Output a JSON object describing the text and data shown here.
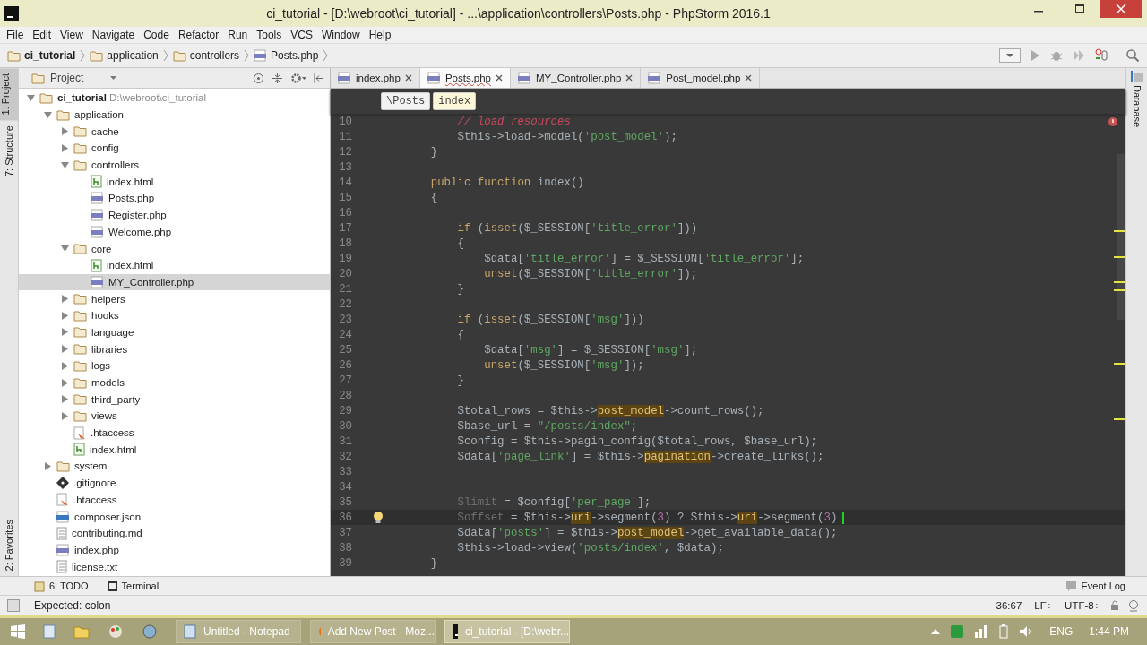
{
  "window": {
    "title": "ci_tutorial - [D:\\webroot\\ci_tutorial] - ...\\application\\controllers\\Posts.php - PhpStorm 2016.1"
  },
  "menu": [
    "File",
    "Edit",
    "View",
    "Navigate",
    "Code",
    "Refactor",
    "Run",
    "Tools",
    "VCS",
    "Window",
    "Help"
  ],
  "nav_bar": [
    {
      "label": "ci_tutorial",
      "kind": "project"
    },
    {
      "label": "application",
      "kind": "folder"
    },
    {
      "label": "controllers",
      "kind": "folder"
    },
    {
      "label": "Posts.php",
      "kind": "php"
    }
  ],
  "left_stripe": [
    {
      "label": "1: Project",
      "selected": true
    },
    {
      "label": "7: Structure",
      "selected": false
    },
    {
      "label": "2: Favorites",
      "selected": false
    }
  ],
  "right_stripe": [
    "Database"
  ],
  "project_panel": {
    "title": "Project",
    "tree": [
      {
        "label": "ci_tutorial",
        "hint": "D:\\webroot\\ci_tutorial",
        "kind": "folder",
        "expanded": true,
        "selected": false,
        "children": [
          {
            "label": "application",
            "kind": "folder",
            "expanded": true,
            "selected": false,
            "children": [
              {
                "label": "cache",
                "kind": "folder",
                "expanded": false,
                "selected": false
              },
              {
                "label": "config",
                "kind": "folder",
                "expanded": false,
                "selected": false
              },
              {
                "label": "controllers",
                "kind": "folder",
                "expanded": true,
                "selected": false,
                "children": [
                  {
                    "label": "index.html",
                    "kind": "html",
                    "selected": false
                  },
                  {
                    "label": "Posts.php",
                    "kind": "php",
                    "selected": false
                  },
                  {
                    "label": "Register.php",
                    "kind": "php",
                    "selected": false
                  },
                  {
                    "label": "Welcome.php",
                    "kind": "php",
                    "selected": false
                  }
                ]
              },
              {
                "label": "core",
                "kind": "folder",
                "expanded": true,
                "selected": false,
                "children": [
                  {
                    "label": "index.html",
                    "kind": "html",
                    "selected": false
                  },
                  {
                    "label": "MY_Controller.php",
                    "kind": "php",
                    "selected": true
                  }
                ]
              },
              {
                "label": "helpers",
                "kind": "folder",
                "expanded": false,
                "selected": false
              },
              {
                "label": "hooks",
                "kind": "folder",
                "expanded": false,
                "selected": false
              },
              {
                "label": "language",
                "kind": "folder",
                "expanded": false,
                "selected": false
              },
              {
                "label": "libraries",
                "kind": "folder",
                "expanded": false,
                "selected": false
              },
              {
                "label": "logs",
                "kind": "folder",
                "expanded": false,
                "selected": false
              },
              {
                "label": "models",
                "kind": "folder",
                "expanded": false,
                "selected": false
              },
              {
                "label": "third_party",
                "kind": "folder",
                "expanded": false,
                "selected": false
              },
              {
                "label": "views",
                "kind": "folder",
                "expanded": false,
                "selected": false
              },
              {
                "label": ".htaccess",
                "kind": "htaccess",
                "selected": false
              },
              {
                "label": "index.html",
                "kind": "html",
                "selected": false
              }
            ]
          },
          {
            "label": "system",
            "kind": "folder",
            "expanded": false,
            "selected": false
          },
          {
            "label": ".gitignore",
            "kind": "git",
            "selected": false
          },
          {
            "label": ".htaccess",
            "kind": "htaccess",
            "selected": false
          },
          {
            "label": "composer.json",
            "kind": "json",
            "selected": false
          },
          {
            "label": "contributing.md",
            "kind": "text",
            "selected": false
          },
          {
            "label": "index.php",
            "kind": "php",
            "selected": false
          },
          {
            "label": "license.txt",
            "kind": "text",
            "selected": false
          }
        ]
      }
    ]
  },
  "editor": {
    "tabs": [
      {
        "label": "index.php",
        "selected": false
      },
      {
        "label": "Posts.php",
        "selected": true
      },
      {
        "label": "MY_Controller.php",
        "selected": false
      },
      {
        "label": "Post_model.php",
        "selected": false
      }
    ],
    "breadcrumb": [
      {
        "label": "\\Posts",
        "selected": false
      },
      {
        "label": "index",
        "selected": true
      }
    ],
    "lines": [
      {
        "number": "10",
        "current": false,
        "tokens": [
          {
            "t": "        // load resources",
            "kind": "comment"
          }
        ]
      },
      {
        "number": "11",
        "current": false,
        "tokens": [
          {
            "t": "        $this->load->model(",
            "kind": "plain"
          },
          {
            "t": "'post_model'",
            "kind": "str"
          },
          {
            "t": ");",
            "kind": "plain"
          }
        ]
      },
      {
        "number": "12",
        "current": false,
        "tokens": [
          {
            "t": "    }",
            "kind": "plain"
          }
        ]
      },
      {
        "number": "13",
        "current": false
      },
      {
        "number": "14",
        "current": false,
        "tokens": [
          {
            "t": "    public function",
            "kind": "kw"
          },
          {
            "t": " index()",
            "kind": "plain"
          }
        ]
      },
      {
        "number": "15",
        "current": false,
        "tokens": [
          {
            "t": "    {",
            "kind": "plain"
          }
        ]
      },
      {
        "number": "16",
        "current": false
      },
      {
        "number": "17",
        "current": false,
        "tokens": [
          {
            "t": "        if",
            "kind": "kw"
          },
          {
            "t": " (",
            "kind": "plain"
          },
          {
            "t": "isset",
            "kind": "kw"
          },
          {
            "t": "($_SESSION[",
            "kind": "plain"
          },
          {
            "t": "'title_error'",
            "kind": "str"
          },
          {
            "t": "]))",
            "kind": "plain"
          }
        ]
      },
      {
        "number": "18",
        "current": false,
        "tokens": [
          {
            "t": "        {",
            "kind": "plain"
          }
        ]
      },
      {
        "number": "19",
        "current": false,
        "tokens": [
          {
            "t": "            $data[",
            "kind": "plain"
          },
          {
            "t": "'title_error'",
            "kind": "str"
          },
          {
            "t": "] = $_SESSION[",
            "kind": "plain"
          },
          {
            "t": "'title_error'",
            "kind": "str"
          },
          {
            "t": "];",
            "kind": "plain"
          }
        ]
      },
      {
        "number": "20",
        "current": false,
        "tokens": [
          {
            "t": "            unset",
            "kind": "kw"
          },
          {
            "t": "($_SESSION[",
            "kind": "plain"
          },
          {
            "t": "'title_error'",
            "kind": "str"
          },
          {
            "t": "]);",
            "kind": "plain"
          }
        ]
      },
      {
        "number": "21",
        "current": false,
        "tokens": [
          {
            "t": "        }",
            "kind": "plain"
          }
        ]
      },
      {
        "number": "22",
        "current": false
      },
      {
        "number": "23",
        "current": false,
        "tokens": [
          {
            "t": "        if",
            "kind": "kw"
          },
          {
            "t": " (",
            "kind": "plain"
          },
          {
            "t": "isset",
            "kind": "kw"
          },
          {
            "t": "($_SESSION[",
            "kind": "plain"
          },
          {
            "t": "'msg'",
            "kind": "str"
          },
          {
            "t": "]))",
            "kind": "plain"
          }
        ]
      },
      {
        "number": "24",
        "current": false,
        "tokens": [
          {
            "t": "        {",
            "kind": "plain"
          }
        ]
      },
      {
        "number": "25",
        "current": false,
        "tokens": [
          {
            "t": "            $data[",
            "kind": "plain"
          },
          {
            "t": "'msg'",
            "kind": "str"
          },
          {
            "t": "] = $_SESSION[",
            "kind": "plain"
          },
          {
            "t": "'msg'",
            "kind": "str"
          },
          {
            "t": "];",
            "kind": "plain"
          }
        ]
      },
      {
        "number": "26",
        "current": false,
        "tokens": [
          {
            "t": "            unset",
            "kind": "kw"
          },
          {
            "t": "($_SESSION[",
            "kind": "plain"
          },
          {
            "t": "'msg'",
            "kind": "str"
          },
          {
            "t": "]);",
            "kind": "plain"
          }
        ]
      },
      {
        "number": "27",
        "current": false,
        "tokens": [
          {
            "t": "        }",
            "kind": "plain"
          }
        ]
      },
      {
        "number": "28",
        "current": false
      },
      {
        "number": "29",
        "current": false,
        "tokens": [
          {
            "t": "        $total_rows = $this->",
            "kind": "plain"
          },
          {
            "t": "post_model",
            "kind": "hl"
          },
          {
            "t": "->count_rows();",
            "kind": "plain"
          }
        ]
      },
      {
        "number": "30",
        "current": false,
        "tokens": [
          {
            "t": "        $base_url = ",
            "kind": "plain"
          },
          {
            "t": "\"/posts/index\"",
            "kind": "str"
          },
          {
            "t": ";",
            "kind": "plain"
          }
        ]
      },
      {
        "number": "31",
        "current": false,
        "tokens": [
          {
            "t": "        $config = $this->pagin_config($total_rows, $base_url);",
            "kind": "plain"
          }
        ]
      },
      {
        "number": "32",
        "current": false,
        "tokens": [
          {
            "t": "        $data[",
            "kind": "plain"
          },
          {
            "t": "'page_link'",
            "kind": "str"
          },
          {
            "t": "] = $this->",
            "kind": "plain"
          },
          {
            "t": "pagination",
            "kind": "hl"
          },
          {
            "t": "->create_links();",
            "kind": "plain"
          }
        ]
      },
      {
        "number": "33",
        "current": false
      },
      {
        "number": "34",
        "current": false
      },
      {
        "number": "35",
        "current": false,
        "tokens": [
          {
            "t": "        $limit",
            "kind": "unused"
          },
          {
            "t": " = $config[",
            "kind": "plain"
          },
          {
            "t": "'per_page'",
            "kind": "str"
          },
          {
            "t": "];",
            "kind": "plain"
          }
        ]
      },
      {
        "number": "36",
        "current": true,
        "tokens": [
          {
            "t": "        $offset",
            "kind": "unused"
          },
          {
            "t": " = $this->",
            "kind": "plain"
          },
          {
            "t": "uri",
            "kind": "hl"
          },
          {
            "t": "->segment(",
            "kind": "plain"
          },
          {
            "t": "3",
            "kind": "num"
          },
          {
            "t": ") ? $this->",
            "kind": "plain"
          },
          {
            "t": "uri",
            "kind": "hl"
          },
          {
            "t": "->segment(",
            "kind": "plain"
          },
          {
            "t": "3",
            "kind": "num"
          },
          {
            "t": ")",
            "kind": "plain"
          }
        ]
      },
      {
        "number": "37",
        "current": false,
        "tokens": [
          {
            "t": "        $data[",
            "kind": "plain"
          },
          {
            "t": "'posts'",
            "kind": "str"
          },
          {
            "t": "] = $this->",
            "kind": "plain"
          },
          {
            "t": "post_model",
            "kind": "hl"
          },
          {
            "t": "->get_available_data();",
            "kind": "plain"
          }
        ]
      },
      {
        "number": "38",
        "current": false,
        "tokens": [
          {
            "t": "        $this->load->view(",
            "kind": "plain"
          },
          {
            "t": "'posts/index'",
            "kind": "str"
          },
          {
            "t": ", $data);",
            "kind": "plain"
          }
        ]
      },
      {
        "number": "39",
        "current": false,
        "tokens": [
          {
            "t": "    }",
            "kind": "plain"
          }
        ]
      }
    ]
  },
  "tool_bar": {
    "left": [
      "6: TODO",
      "Terminal"
    ],
    "right": "Event Log"
  },
  "status_bar": {
    "message": "Expected: colon",
    "position": "36:67",
    "line_separator": "LF÷",
    "encoding": "UTF-8÷"
  },
  "taskbar": {
    "windows": [
      {
        "label": "Untitled - Notepad",
        "kind": "notepad",
        "selected": false
      },
      {
        "label": "Add New Post - Moz...",
        "kind": "firefox",
        "selected": false
      },
      {
        "label": "ci_tutorial - [D:\\webr...",
        "kind": "phpstorm",
        "selected": true
      }
    ],
    "language": "ENG",
    "time": "1:44 PM"
  }
}
